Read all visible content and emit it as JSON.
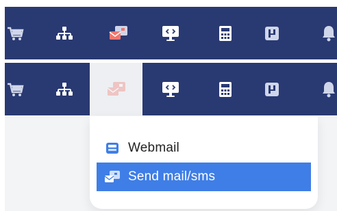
{
  "colors": {
    "navbar_bg": "#293972",
    "active_tab_bg": "#edeff2",
    "highlight": "#3f7ee6",
    "mail_icon_accent": "#f0786f",
    "webmail_icon": "#3f7ee6"
  },
  "toolbar": {
    "icons": [
      "shopping-cart-icon",
      "sitemap-icon",
      "mail-sms-icon",
      "remote-desktop-icon",
      "calculator-icon",
      "layout-toggle-icon",
      "notification-bell-icon"
    ]
  },
  "dropdown": {
    "items": [
      {
        "label": "Webmail",
        "icon": "webmail-icon"
      },
      {
        "label": "Send mail/sms",
        "icon": "send-mail-sms-icon",
        "highlighted": true
      }
    ]
  }
}
